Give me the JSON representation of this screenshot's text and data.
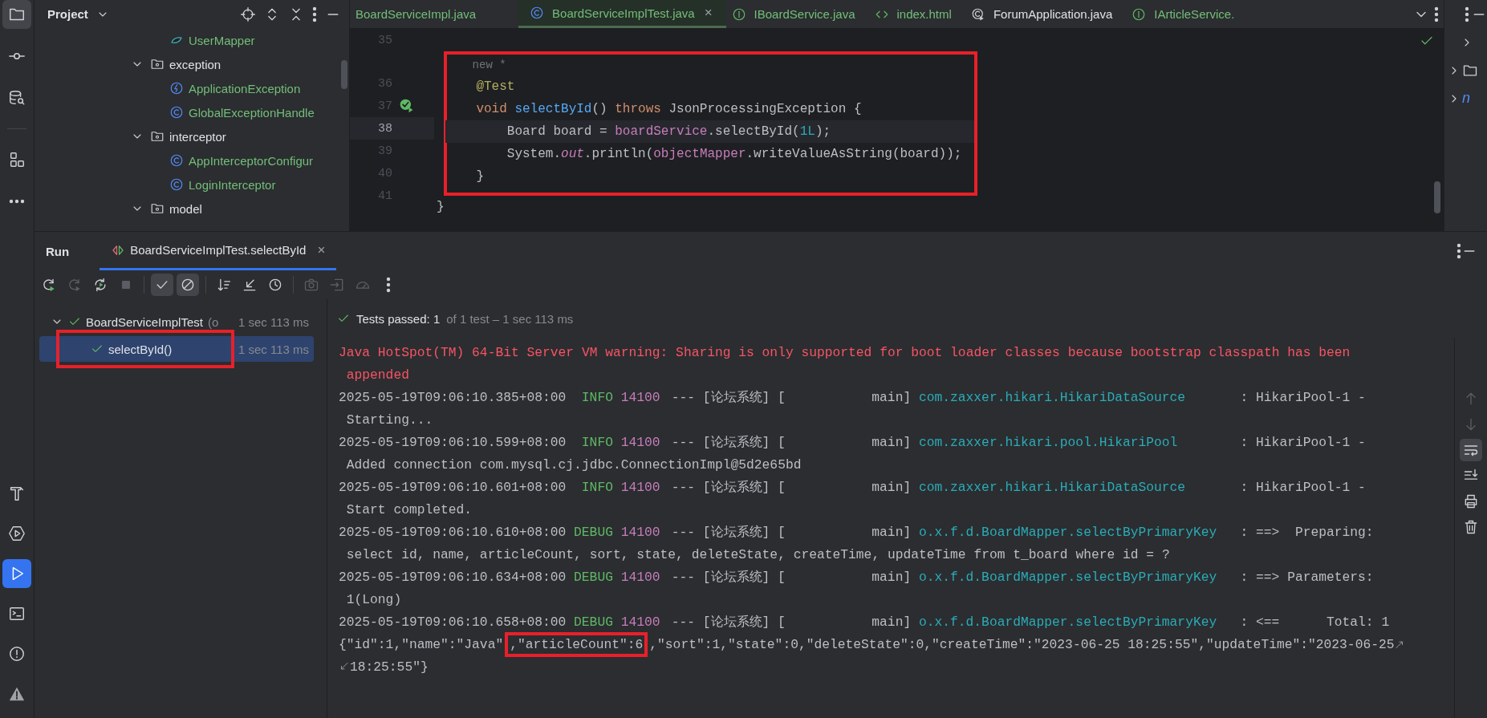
{
  "tool_strip": {
    "top": [
      {
        "kind": "project",
        "selected": true
      },
      {
        "kind": "commit",
        "selected": false
      },
      {
        "kind": "database",
        "selected": false
      },
      {
        "kind": "structure",
        "selected": false
      },
      {
        "kind": "more",
        "selected": false
      }
    ],
    "bottom": [
      {
        "kind": "build",
        "selected": false
      },
      {
        "kind": "services",
        "selected": false
      },
      {
        "kind": "run",
        "selected": true
      },
      {
        "kind": "terminal",
        "selected": false
      },
      {
        "kind": "problems",
        "selected": false
      },
      {
        "kind": "warning",
        "selected": false
      }
    ]
  },
  "project_panel": {
    "title": "Project",
    "tree": [
      {
        "kind": "offscreen",
        "children": [
          {
            "name": "UserMapper",
            "kind": "mapper",
            "color": "#73bd79"
          }
        ]
      },
      {
        "name": "exception",
        "kind": "package",
        "expanded": true,
        "color": "#dfe1e5",
        "children": [
          {
            "name": "ApplicationException",
            "kind": "exception",
            "color": "#73bd79"
          },
          {
            "name": "GlobalExceptionHandle",
            "kind": "class",
            "color": "#73bd79"
          }
        ]
      },
      {
        "name": "interceptor",
        "kind": "package",
        "expanded": true,
        "color": "#dfe1e5",
        "children": [
          {
            "name": "AppInterceptorConfigur",
            "kind": "class",
            "color": "#73bd79"
          },
          {
            "name": "LoginInterceptor",
            "kind": "class",
            "color": "#73bd79"
          }
        ]
      },
      {
        "name": "model",
        "kind": "package",
        "expanded": true,
        "color": "#dfe1e5"
      }
    ]
  },
  "editor": {
    "tabs": [
      {
        "label": "BoardServiceImpl.java",
        "kind": "none",
        "color": "#73bd79",
        "selected": false
      },
      {
        "label": "BoardServiceImplTest.java",
        "kind": "class",
        "color": "#73bd79",
        "selected": true,
        "close": "×"
      },
      {
        "label": "IBoardService.java",
        "kind": "interface",
        "color": "#73bd79",
        "selected": false
      },
      {
        "label": "index.html",
        "kind": "html",
        "color": "#73bd79",
        "selected": false
      },
      {
        "label": "ForumApplication.java",
        "kind": "app",
        "color": "#dfe1e5",
        "selected": false
      },
      {
        "label": "IArticleService.",
        "kind": "interface",
        "color": "#73bd79",
        "selected": false
      }
    ],
    "lines": [
      {
        "kind": "code",
        "number": "35",
        "framed": false,
        "current": false,
        "run_marker": false
      },
      {
        "kind": "hint",
        "text": "new *",
        "framed": true
      },
      {
        "kind": "code",
        "number": "36",
        "framed": true,
        "current": false,
        "run_marker": false,
        "tokens": [
          {
            "kind": "ann",
            "text": "    @Test"
          }
        ]
      },
      {
        "kind": "code",
        "number": "37",
        "framed": true,
        "current": false,
        "run_marker": true,
        "tokens": [
          {
            "kind": "kw",
            "text": "    void"
          },
          {
            "kind": "decl",
            "text": " selectById"
          },
          {
            "kind": "plain",
            "text": "() "
          },
          {
            "kind": "kw",
            "text": "throws"
          },
          {
            "kind": "plain",
            "text": " JsonProcessingException {"
          }
        ]
      },
      {
        "kind": "code",
        "number": "38",
        "framed": true,
        "current": true,
        "run_marker": false,
        "tokens": [
          {
            "kind": "plain",
            "text": "        Board board = "
          },
          {
            "kind": "field",
            "text": "boardService"
          },
          {
            "kind": "plain",
            "text": ".selectById("
          },
          {
            "kind": "num",
            "text": "1L"
          },
          {
            "kind": "plain",
            "text": ");"
          }
        ]
      },
      {
        "kind": "code",
        "number": "39",
        "framed": true,
        "current": false,
        "run_marker": false,
        "tokens": [
          {
            "kind": "plain",
            "text": "        System."
          },
          {
            "kind": "static",
            "text": "out"
          },
          {
            "kind": "plain",
            "text": ".println("
          },
          {
            "kind": "field",
            "text": "objectMapper"
          },
          {
            "kind": "plain",
            "text": ".writeValueAsString(board));"
          }
        ]
      },
      {
        "kind": "code",
        "number": "40",
        "framed": true,
        "current": false,
        "run_marker": false,
        "tokens": [
          {
            "kind": "plain",
            "text": "    }"
          }
        ]
      },
      {
        "kind": "code",
        "number": "41",
        "framed": false,
        "current": false,
        "run_marker": false,
        "tokens": [
          {
            "kind": "plain",
            "text": "}"
          }
        ]
      }
    ]
  },
  "right_panel": {
    "text": "n"
  },
  "run_panel": {
    "title": "Run",
    "tabs": [
      {
        "label": "BoardServiceImplTest.selectById",
        "selected": true,
        "close": "×"
      }
    ],
    "toolbar": [
      {
        "kind": "rerun",
        "on": false,
        "disabled": false
      },
      {
        "kind": "rerun-failed",
        "on": false,
        "disabled": true
      },
      {
        "kind": "toggle-auto",
        "on": false,
        "disabled": false
      },
      {
        "kind": "stop",
        "on": false,
        "disabled": true
      },
      {
        "kind": "sep"
      },
      {
        "kind": "show-passed",
        "on": true,
        "disabled": false
      },
      {
        "kind": "show-ignored",
        "on": true,
        "disabled": false
      },
      {
        "kind": "sep"
      },
      {
        "kind": "sort",
        "on": false,
        "disabled": false
      },
      {
        "kind": "collapse",
        "on": false,
        "disabled": false
      },
      {
        "kind": "history",
        "on": false,
        "disabled": false
      },
      {
        "kind": "sep"
      },
      {
        "kind": "camera",
        "on": false,
        "disabled": true
      },
      {
        "kind": "import",
        "on": false,
        "disabled": true
      },
      {
        "kind": "gauge",
        "on": false,
        "disabled": true
      },
      {
        "kind": "more",
        "on": false,
        "disabled": false
      }
    ],
    "tests": [
      {
        "name": "BoardServiceImplTest",
        "suffix": "(o",
        "time": "1 sec 113 ms",
        "passed": true,
        "expanded": true,
        "selected": false,
        "framed": false,
        "children": [
          {
            "name": "selectById()",
            "time": "1 sec 113 ms",
            "passed": true,
            "selected": true,
            "framed": true
          }
        ]
      }
    ],
    "status": {
      "passed": true,
      "text": "Tests passed: 1",
      "detail": "of 1 test – 1 sec 113 ms"
    },
    "console": [
      {
        "kind": "error",
        "text": "Java HotSpot(TM) 64-Bit Server VM warning: Sharing is only supported for boot loader classes because bootstrap classpath has been"
      },
      {
        "kind": "error-cont",
        "text": "appended"
      },
      {
        "kind": "log",
        "time": "2025-05-19T09:06:10.385+08:00",
        "level": "INFO",
        "pid": "14100",
        "thread": "--- [论坛系统] [           main]",
        "logger": "com.zaxxer.hikari.HikariDataSource",
        "message": ": HikariPool-1 -"
      },
      {
        "kind": "cont",
        "text": "Starting..."
      },
      {
        "kind": "log",
        "time": "2025-05-19T09:06:10.599+08:00",
        "level": "INFO",
        "pid": "14100",
        "thread": "--- [论坛系统] [           main]",
        "logger": "com.zaxxer.hikari.pool.HikariPool",
        "message": ": HikariPool-1 -"
      },
      {
        "kind": "cont",
        "text": "Added connection com.mysql.cj.jdbc.ConnectionImpl@5d2e65bd"
      },
      {
        "kind": "log",
        "time": "2025-05-19T09:06:10.601+08:00",
        "level": "INFO",
        "pid": "14100",
        "thread": "--- [论坛系统] [           main]",
        "logger": "com.zaxxer.hikari.HikariDataSource",
        "message": ": HikariPool-1 -"
      },
      {
        "kind": "cont",
        "text": "Start completed."
      },
      {
        "kind": "log",
        "time": "2025-05-19T09:06:10.610+08:00",
        "level": "DEBUG",
        "pid": "14100",
        "thread": "--- [论坛系统] [           main]",
        "logger": "o.x.f.d.BoardMapper.selectByPrimaryKey",
        "message": ": ==>  Preparing:"
      },
      {
        "kind": "cont",
        "text": "select id, name, articleCount, sort, state, deleteState, createTime, updateTime from t_board where id = ?"
      },
      {
        "kind": "log",
        "time": "2025-05-19T09:06:10.634+08:00",
        "level": "DEBUG",
        "pid": "14100",
        "thread": "--- [论坛系统] [           main]",
        "logger": "o.x.f.d.BoardMapper.selectByPrimaryKey",
        "message": ": ==> Parameters:"
      },
      {
        "kind": "cont",
        "text": "1(Long)"
      },
      {
        "kind": "log",
        "time": "2025-05-19T09:06:10.658+08:00",
        "level": "DEBUG",
        "pid": "14100",
        "thread": "--- [论坛系统] [           main]",
        "logger": "o.x.f.d.BoardMapper.selectByPrimaryKey",
        "message": ": <==      Total: 1"
      },
      {
        "kind": "json",
        "wrap_out": true,
        "wrap_in": false,
        "parts": [
          {
            "text": "{\"id\":1,\"name\":\"Java\"",
            "framed": false
          },
          {
            "text": ",\"articleCount\":6",
            "framed": true
          },
          {
            "text": ",\"sort\":1,\"state\":0,\"deleteState\":0,\"createTime\":\"2023-06-25 18:25:55\",\"updateTime\":\"2023-06-25",
            "framed": false
          }
        ]
      },
      {
        "kind": "json",
        "wrap_out": false,
        "wrap_in": true,
        "parts": [
          {
            "text": "18:25:55\"}",
            "framed": false
          }
        ]
      }
    ],
    "console_toolbar": [
      {
        "kind": "up",
        "on": false,
        "disabled": true
      },
      {
        "kind": "down",
        "on": false,
        "disabled": true
      },
      {
        "kind": "softwrap",
        "on": true,
        "disabled": false
      },
      {
        "kind": "scroll-end",
        "on": false,
        "disabled": false
      },
      {
        "kind": "print",
        "on": false,
        "disabled": false
      },
      {
        "kind": "trash",
        "on": false,
        "disabled": false
      }
    ]
  }
}
